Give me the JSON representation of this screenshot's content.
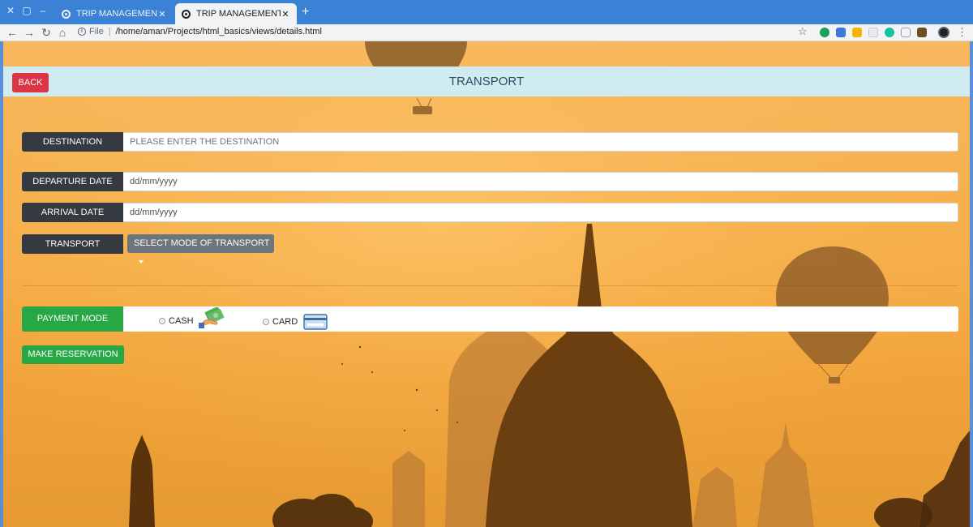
{
  "browser": {
    "tabs": [
      {
        "title": "TRIP MANAGEMENT"
      },
      {
        "title": "TRIP MANAGEMENT"
      }
    ],
    "address": {
      "scheme_label": "File",
      "url": "/home/aman/Projects/html_basics/views/details.html"
    }
  },
  "header": {
    "back_label": "BACK",
    "title": "TRANSPORT"
  },
  "form": {
    "destination": {
      "label": "DESTINATION",
      "placeholder": "PLEASE ENTER THE DESTINATION",
      "value": ""
    },
    "departure_date": {
      "label": "DEPARTURE DATE",
      "value": "dd/mm/yyyy"
    },
    "arrival_date": {
      "label": "ARRIVAL DATE",
      "value": "dd/mm/yyyy"
    },
    "transport": {
      "label": "TRANSPORT",
      "selected": "SELECT MODE OF TRANSPORT"
    },
    "payment": {
      "label": "PAYMENT MODE",
      "options": [
        {
          "label": "CASH",
          "icon": "cash-icon",
          "checked": false
        },
        {
          "label": "CARD",
          "icon": "credit-card-icon",
          "checked": false
        }
      ]
    },
    "submit_label": "MAKE RESERVATION"
  },
  "colors": {
    "danger": "#dc3545",
    "success": "#28a745",
    "dark": "#343a40",
    "secondary": "#6c757d",
    "header_bg": "#d1ecf1",
    "page_bg": "#f6ae48"
  }
}
